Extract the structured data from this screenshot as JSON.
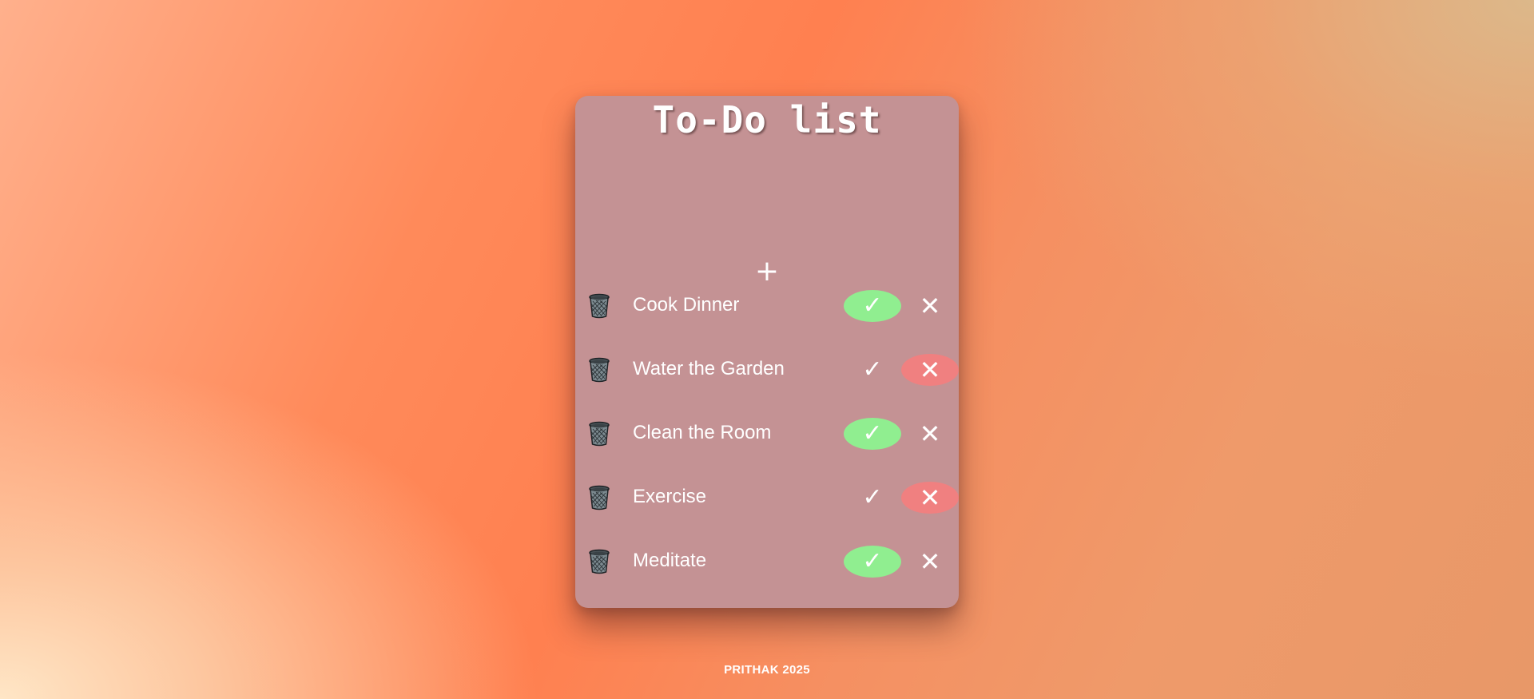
{
  "app": {
    "title": "To-Do list",
    "add_label": "+"
  },
  "icons": {
    "trash": "trash-can-icon",
    "check": "checkmark-icon",
    "cross": "close-x-icon"
  },
  "colors": {
    "card": "#c49294",
    "done_active": "#90ee90",
    "cancel_active": "#f08080",
    "text": "#ffffff"
  },
  "tasks": [
    {
      "label": "Cook Dinner",
      "status": "done",
      "check_symbol": "✓",
      "cross_symbol": "✕"
    },
    {
      "label": "Water the Garden",
      "status": "cancelled",
      "check_symbol": "✓",
      "cross_symbol": "✕"
    },
    {
      "label": "Clean the Room",
      "status": "done",
      "check_symbol": "✓",
      "cross_symbol": "✕"
    },
    {
      "label": "Exercise",
      "status": "cancelled",
      "check_symbol": "✓",
      "cross_symbol": "✕"
    },
    {
      "label": "Meditate",
      "status": "done",
      "check_symbol": "✓",
      "cross_symbol": "✕"
    }
  ],
  "footer": {
    "text": "PRITHAK 2025"
  }
}
